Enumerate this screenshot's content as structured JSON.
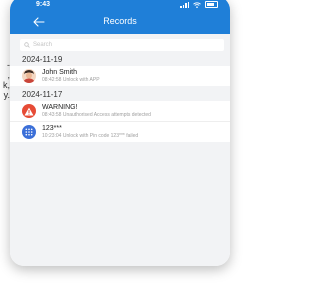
{
  "side_text": "\n\n\n\n-\n,\nk,\ny.",
  "status": {
    "time": "9:43"
  },
  "header": {
    "title": "Records"
  },
  "search": {
    "placeholder": "Search"
  },
  "groups": [
    {
      "date": "2024-11-19",
      "records": [
        {
          "title": "John Smith",
          "subtitle": "08:42:58 Unlock with APP",
          "icon": "user-avatar-icon"
        }
      ]
    },
    {
      "date": "2024-11-17",
      "records": [
        {
          "title": "WARNING!",
          "subtitle": "08:43:58 Unauthorised Access attempts detected",
          "icon": "warning-icon"
        },
        {
          "title": "123***",
          "subtitle": "10:23:04 Unlock with Pin code 123*** failed",
          "icon": "keypad-icon"
        }
      ]
    }
  ],
  "colors": {
    "header": "#1f7fd8",
    "warning": "#e64b36",
    "keypad": "#3b6fd8",
    "background": "#f2f3f5"
  }
}
